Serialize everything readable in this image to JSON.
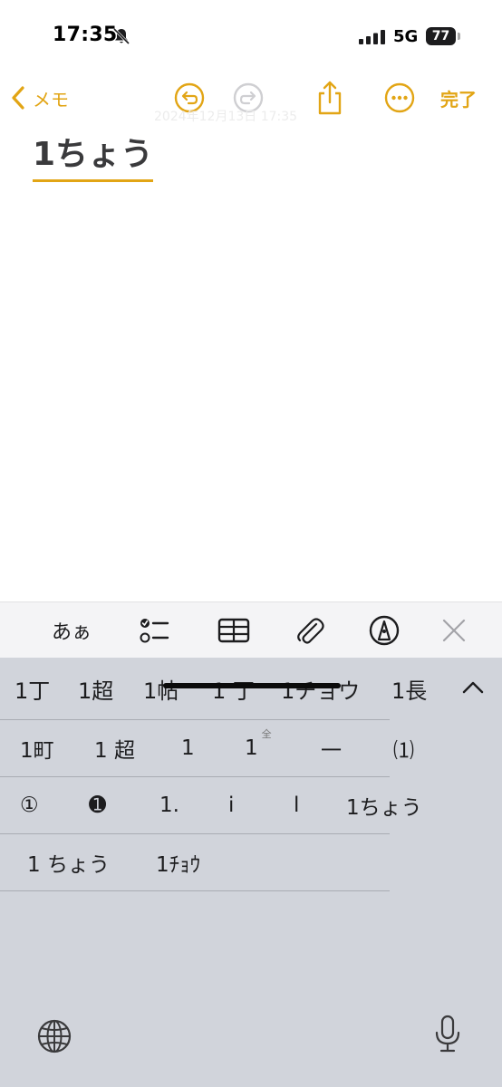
{
  "status_bar": {
    "time": "17:35",
    "network": "5G",
    "battery": "77"
  },
  "toolbar": {
    "back_label": "メモ",
    "done_label": "完了",
    "faint_date": "2024年12月13日 17:35"
  },
  "note": {
    "text": "1ちょう"
  },
  "keyboard_toolbar": {
    "aa_label": "あぁ"
  },
  "candidates": {
    "row1": [
      "1丁",
      "1超",
      "1帖",
      "1 丁",
      "1チョウ",
      "1長"
    ],
    "grid": [
      [
        "1町",
        "1 超",
        "1",
        "1",
        "一",
        "⑴"
      ],
      [
        "①",
        "➊",
        "1.",
        "i",
        "l",
        "1ちょう"
      ],
      [
        "1 ちょう",
        "1ﾁｮｳ"
      ]
    ],
    "fullwidth_mark": "全"
  },
  "colors": {
    "accent": "#e2a515",
    "keyboard_bg": "#d1d4db",
    "toolbar_bg": "#f4f4f6"
  },
  "icons": {
    "back": "chevron-left-icon",
    "undo": "undo-icon",
    "redo": "redo-icon",
    "share": "share-icon",
    "more": "more-icon",
    "checklist": "checklist-icon",
    "table": "table-icon",
    "attach": "paperclip-icon",
    "markup": "markup-pen-icon",
    "close": "close-icon",
    "globe": "globe-icon",
    "mic": "microphone-icon"
  }
}
